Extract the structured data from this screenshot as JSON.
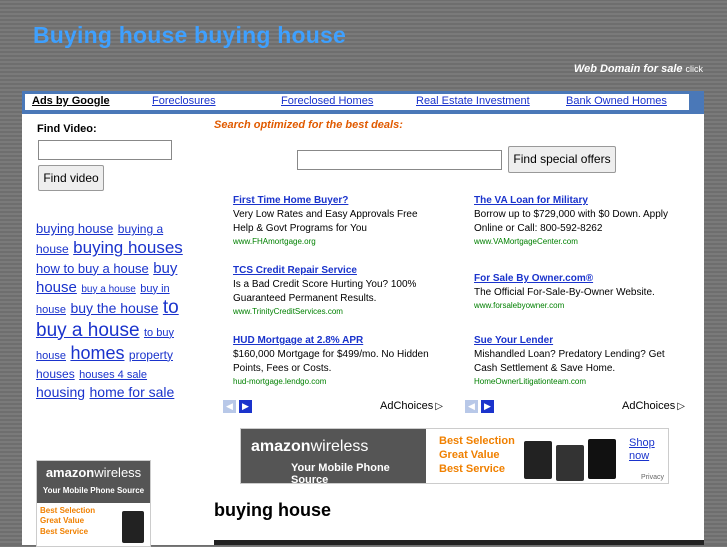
{
  "site": {
    "title": "Buying house buying house",
    "domain_sale": "Web Domain for sale",
    "domain_click": "click"
  },
  "nav": {
    "ads_by": "Ads by Google",
    "links": [
      "Foreclosures",
      "Foreclosed Homes",
      "Real Estate Investment",
      "Bank Owned Homes"
    ]
  },
  "sidebar": {
    "find_video_label": "Find Video:",
    "find_video_value": "",
    "find_video_button": "Find video",
    "tags": [
      "buying house",
      "buying a house",
      "buying houses",
      "how to buy a house",
      "buy house",
      "buy a house",
      "buy in house",
      "buy the house",
      "to buy a house",
      "to buy house",
      "homes",
      "property houses",
      "houses 4 sale",
      "housing",
      "home for sale"
    ],
    "banner": {
      "brand_bold": "amazon",
      "brand_rest": "wireless",
      "sub": "Your Mobile Phone Source",
      "features": [
        "Best Selection",
        "Great Value",
        "Best Service"
      ]
    }
  },
  "main": {
    "search_tagline": "Search optimized for the best deals:",
    "search_value": "",
    "search_button": "Find special offers",
    "ads": [
      {
        "title": "First Time Home Buyer?",
        "desc": "Very Low Rates and Easy Approvals Free Help & Govt Programs for You",
        "url": "www.FHAmortgage.org"
      },
      {
        "title": "TCS Credit Repair Service",
        "desc": "Is a Bad Credit Score Hurting You? 100% Guaranteed Permanent Results.",
        "url": "www.TrinityCreditServices.com"
      },
      {
        "title": "HUD Mortgage at 2.8% APR",
        "desc": "$160,000 Mortgage for $499/mo. No Hidden Points, Fees or Costs.",
        "url": "hud-mortgage.lendgo.com"
      },
      {
        "title": "The VA Loan for Military",
        "desc": "Borrow up to $729,000 with $0 Down. Apply Online or Call: 800-592-8262",
        "url": "www.VAMortgageCenter.com"
      },
      {
        "title": "For Sale By Owner.com®",
        "desc": "The Official For-Sale-By-Owner Website.",
        "url": "www.forsalebyowner.com"
      },
      {
        "title": "Sue Your Lender",
        "desc": "Mishandled Loan? Predatory Lending? Get Cash Settlement & Save Home.",
        "url": "HomeOwnerLitigationteam.com"
      }
    ],
    "adchoices": "AdChoices",
    "banner": {
      "brand_bold": "amazon",
      "brand_rest": "wireless",
      "sub": "Your Mobile Phone Source",
      "features": [
        "Best Selection",
        "Great Value",
        "Best Service"
      ],
      "shop": "Shop now",
      "privacy": "Privacy"
    },
    "heading": "buying house"
  },
  "colors": {
    "title_blue": "#3ea0ff",
    "nav_blue": "#4a78b8",
    "link_blue": "#1a33cc",
    "tagline_orange": "#e05a00",
    "url_green": "#008000",
    "feature_orange": "#f08000"
  },
  "icons": {
    "prev_arrow": "chevron-left-icon",
    "next_arrow": "chevron-right-icon",
    "adchoices": "adchoices-triangle-icon"
  }
}
